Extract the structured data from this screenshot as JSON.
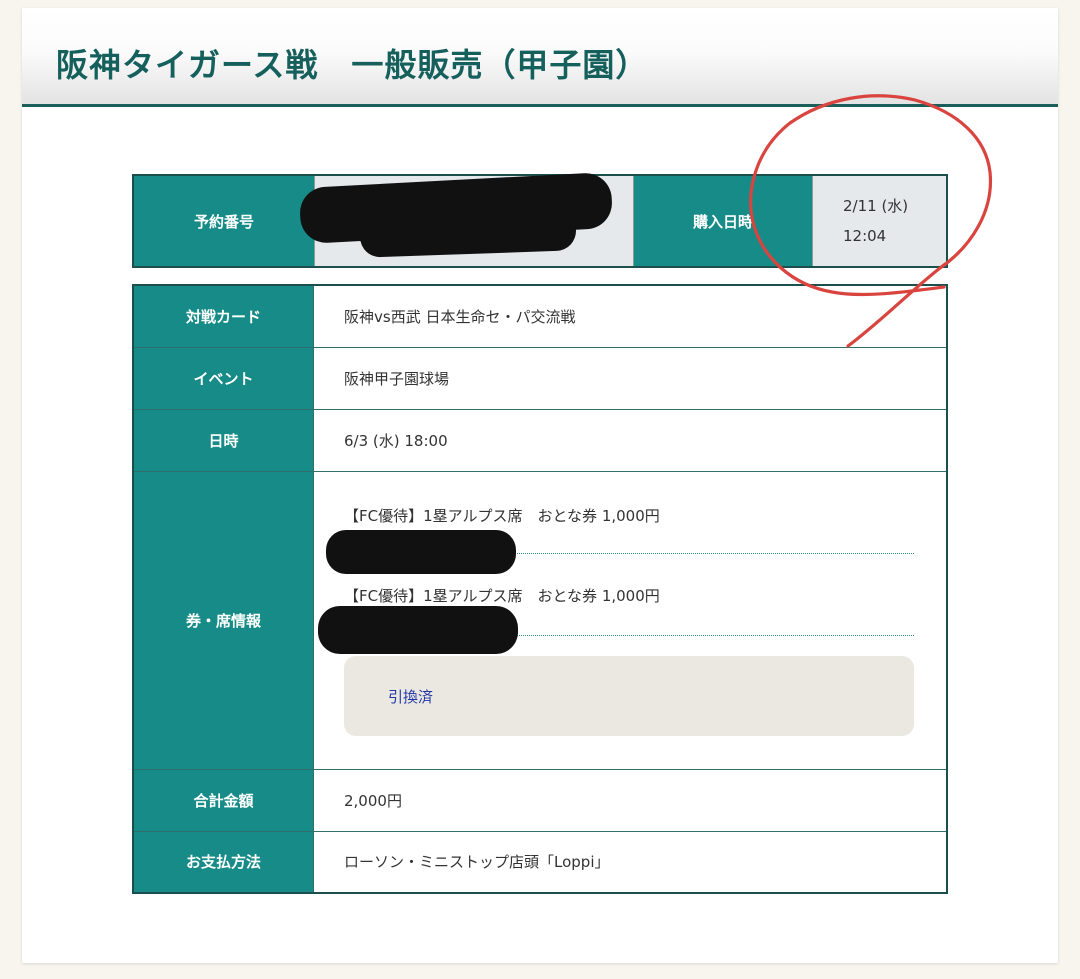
{
  "header": {
    "title": "阪神タイガース戦　一般販売（甲子園）"
  },
  "order": {
    "reservation_label": "予約番号",
    "purchase_label": "購入日時",
    "purchase_date": "2/11 (水)",
    "purchase_time": "12:04"
  },
  "details": {
    "match_label": "対戦カード",
    "match_value": "阪神vs西武 日本生命セ・パ交流戦",
    "event_label": "イベント",
    "event_value": "阪神甲子園球場",
    "datetime_label": "日時",
    "datetime_value": "6/3 (水) 18:00",
    "tickets_label": "券・席情報",
    "tickets": [
      {
        "line": "【FC優待】1塁アルプス席　おとな券 1,000円"
      },
      {
        "line": "【FC優待】1塁アルプス席　おとな券 1,000円"
      }
    ],
    "exchange_status": "引換済",
    "total_label": "合計金額",
    "total_value": "2,000円",
    "payment_label": "お支払方法",
    "payment_value": "ローソン・ミニストップ店頭「Loppi」"
  },
  "colors": {
    "header_accent": "#15605c",
    "label_bg": "#168b87",
    "annotation": "#d9443f"
  }
}
